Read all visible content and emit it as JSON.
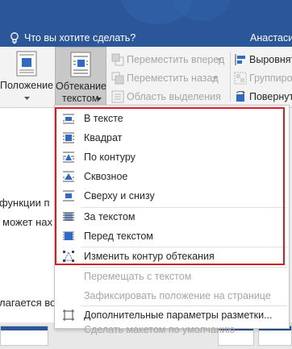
{
  "tell_me": {
    "placeholder": "Что вы хотите сделать?",
    "user_name": "Анастаси"
  },
  "ribbon": {
    "position_label": "Положение",
    "wrap_text_line1": "Обтекание",
    "wrap_text_line2": "текстом",
    "bring_forward": "Переместить вперед",
    "send_backward": "Переместить назад",
    "selection_pane": "Область выделения",
    "align": "Выровнять",
    "group": "Группиро",
    "rotate": "Повернут"
  },
  "document": {
    "line1": "функции п",
    "line2": "может нах",
    "line3": "лагается во"
  },
  "wrap_menu": {
    "items": [
      {
        "label": "В тексте",
        "icon": "wrap-inline-icon"
      },
      {
        "label": "Квадрат",
        "icon": "wrap-square-icon"
      },
      {
        "label": "По контуру",
        "icon": "wrap-tight-icon"
      },
      {
        "label": "Сквозное",
        "icon": "wrap-through-icon"
      },
      {
        "label": "Сверху и снизу",
        "icon": "wrap-top-bottom-icon"
      },
      {
        "label": "За текстом",
        "icon": "wrap-behind-text-icon"
      },
      {
        "label": "Перед текстом",
        "icon": "wrap-in-front-icon"
      },
      {
        "label": "Изменить контур обтекания",
        "icon": "edit-wrap-points-icon"
      },
      {
        "label": "Перемещать с текстом"
      },
      {
        "label": "Зафиксировать положение на странице"
      },
      {
        "label": "Дополнительные параметры разметки...",
        "icon": "layout-options-icon"
      },
      {
        "label": "Сделать макетом по умолчанию"
      }
    ]
  },
  "colors": {
    "title_bar": "#2b579a",
    "ribbon_bg": "#f3f3f3",
    "highlight_border": "#d41d25",
    "icon_blue": "#2e6bc6",
    "disabled_text": "#a6a6a6"
  }
}
